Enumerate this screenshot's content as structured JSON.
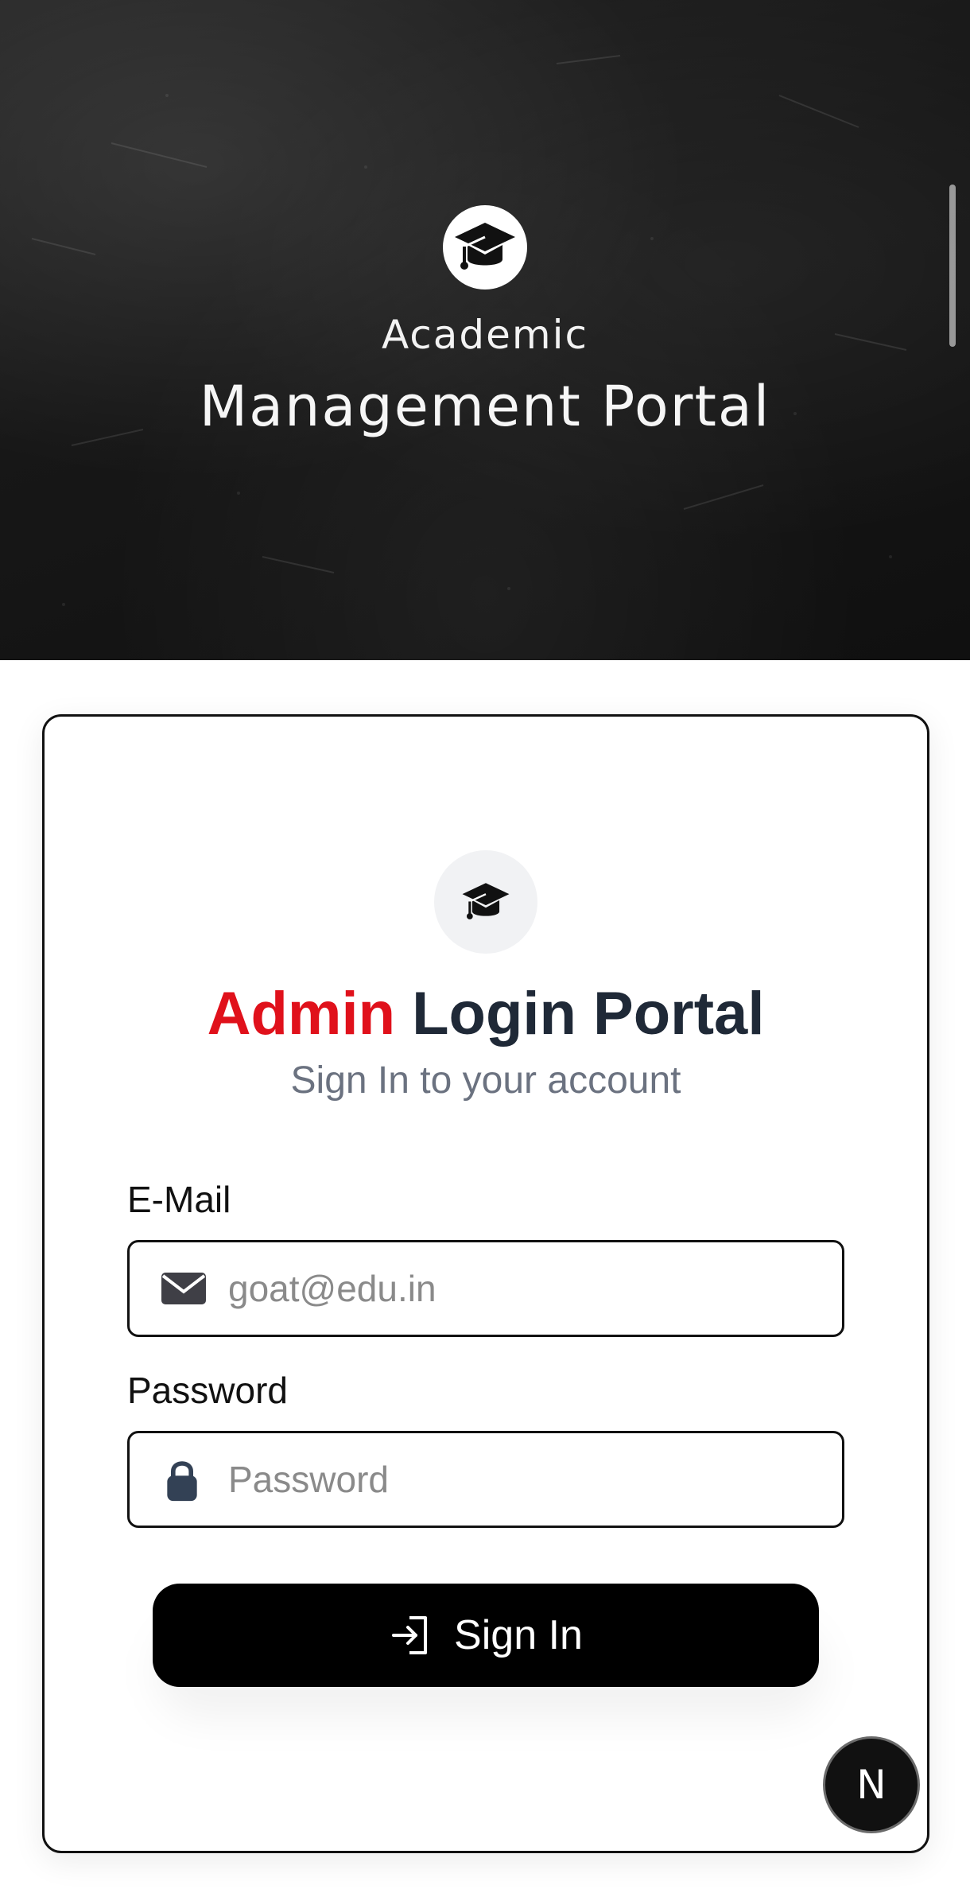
{
  "hero": {
    "kicker": "Academic",
    "title": "Management Portal",
    "logo_icon": "graduation-cap-icon"
  },
  "card": {
    "logo_icon": "graduation-cap-icon",
    "title_highlight": "Admin",
    "title_rest": "Login Portal",
    "subtitle": "Sign In to your account",
    "accent_color": "#e0111b"
  },
  "form": {
    "email": {
      "label": "E-Mail",
      "placeholder": "goat@edu.in",
      "value": "",
      "icon": "envelope-icon"
    },
    "password": {
      "label": "Password",
      "placeholder": "Password",
      "value": "",
      "icon": "lock-icon"
    },
    "submit": {
      "label": "Sign In",
      "icon": "sign-in-icon"
    }
  },
  "fab": {
    "letter": "N"
  }
}
